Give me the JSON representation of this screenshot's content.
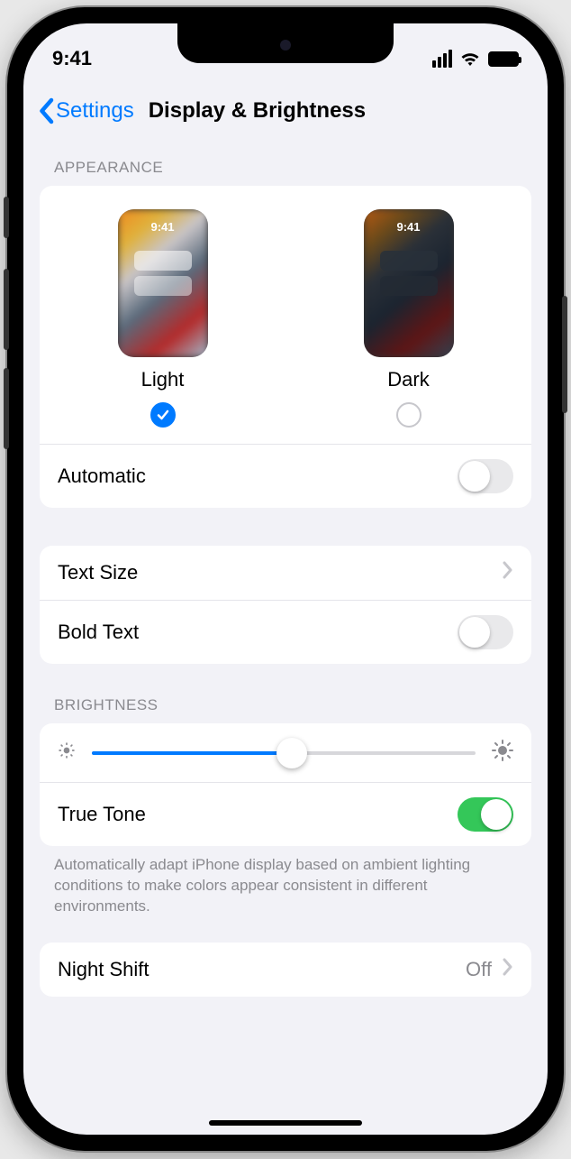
{
  "status": {
    "time": "9:41"
  },
  "nav": {
    "back": "Settings",
    "title": "Display & Brightness"
  },
  "appearance": {
    "header": "Appearance",
    "preview_time": "9:41",
    "light": {
      "label": "Light",
      "selected": true
    },
    "dark": {
      "label": "Dark",
      "selected": false
    },
    "automatic_label": "Automatic"
  },
  "text": {
    "size_label": "Text Size",
    "bold_label": "Bold Text"
  },
  "brightness": {
    "header": "Brightness",
    "value_pct": 52,
    "truetone_label": "True Tone",
    "truetone_on": true,
    "footnote": "Automatically adapt iPhone display based on ambient lighting conditions to make colors appear consistent in different environments."
  },
  "nightshift": {
    "label": "Night Shift",
    "value": "Off"
  }
}
